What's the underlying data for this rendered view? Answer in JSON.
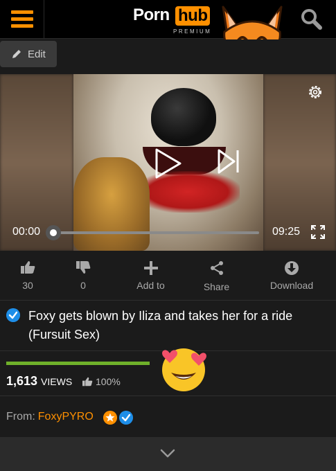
{
  "header": {
    "logo_porn": "Porn",
    "logo_hub": "hub",
    "logo_premium": "PREMIUM"
  },
  "editbar": {
    "edit_label": "Edit"
  },
  "player": {
    "current_time": "00:00",
    "duration": "09:25",
    "progress_fraction": 0
  },
  "actions": {
    "likes": "30",
    "dislikes": "0",
    "add_to": "Add to",
    "share": "Share",
    "download": "Download"
  },
  "video_info": {
    "title": "Foxy gets blown by Iliza and takes her for a ride (Fursuit Sex)",
    "views_count": "1,613",
    "views_label": "VIEWS",
    "rating_percent_label": "100%",
    "rating_fraction": 1.0
  },
  "uploader": {
    "from_label": "From:",
    "name": "FoxyPYRO"
  },
  "colors": {
    "brand_orange": "#ff9000",
    "verified_blue": "#1e8ee8",
    "rating_green": "#6fb02a",
    "background": "#1b1b1b"
  },
  "icons": [
    "menu-icon",
    "search-icon",
    "fox-emoji-icon",
    "pencil-icon",
    "gear-icon",
    "play-icon",
    "skip-next-icon",
    "fullscreen-icon",
    "thumbs-up-icon",
    "thumbs-down-icon",
    "plus-icon",
    "share-icon",
    "download-icon",
    "verified-check-icon",
    "heart-eyes-emoji-icon",
    "star-badge-icon",
    "chevron-down-icon"
  ]
}
